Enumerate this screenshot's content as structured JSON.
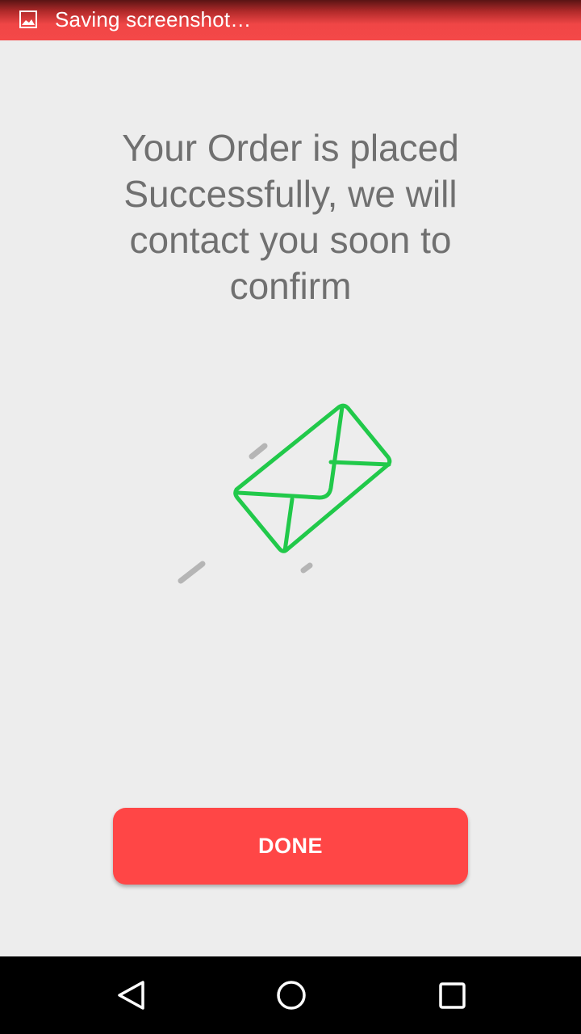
{
  "status_bar": {
    "notification_icon": "image-icon",
    "notification_text": "Saving screenshot…",
    "background_color": "#f44848"
  },
  "main": {
    "message": "Your Order is placed Successfully, we will contact you soon to confirm",
    "illustration_icon": "envelope-icon",
    "illustration_color": "#21c94a",
    "done_button_label": "DONE",
    "done_button_color": "#ff4646"
  },
  "nav_bar": {
    "back_icon": "back-triangle-icon",
    "home_icon": "home-circle-icon",
    "recents_icon": "recents-square-icon"
  }
}
